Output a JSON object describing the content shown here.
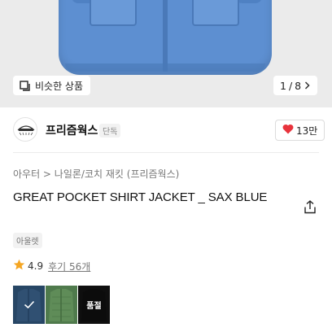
{
  "gallery": {
    "similar_label": "비슷한 상품",
    "counter_current": "1",
    "counter_separator": "/",
    "counter_total": "8"
  },
  "brand": {
    "name": "프리즘웍스",
    "tag": "단독",
    "likes": "13만"
  },
  "product": {
    "breadcrumb": "아우터 > 나일론/코치 재킷 (프리즘웍스)",
    "title": "GREAT POCKET SHIRT JACKET _ SAX BLUE",
    "tag": "아울렛",
    "rating": "4.9",
    "reviews": "후기 56개"
  },
  "swatches": [
    {
      "color": "blue",
      "selected": true
    },
    {
      "color": "green",
      "selected": false
    },
    {
      "color": "black",
      "soldout_label": "품절"
    }
  ],
  "colors": {
    "heart": "#e8333c",
    "star": "#f5a623",
    "hero_bg": "#ebebeb",
    "shirt": "#5d8fd1"
  }
}
